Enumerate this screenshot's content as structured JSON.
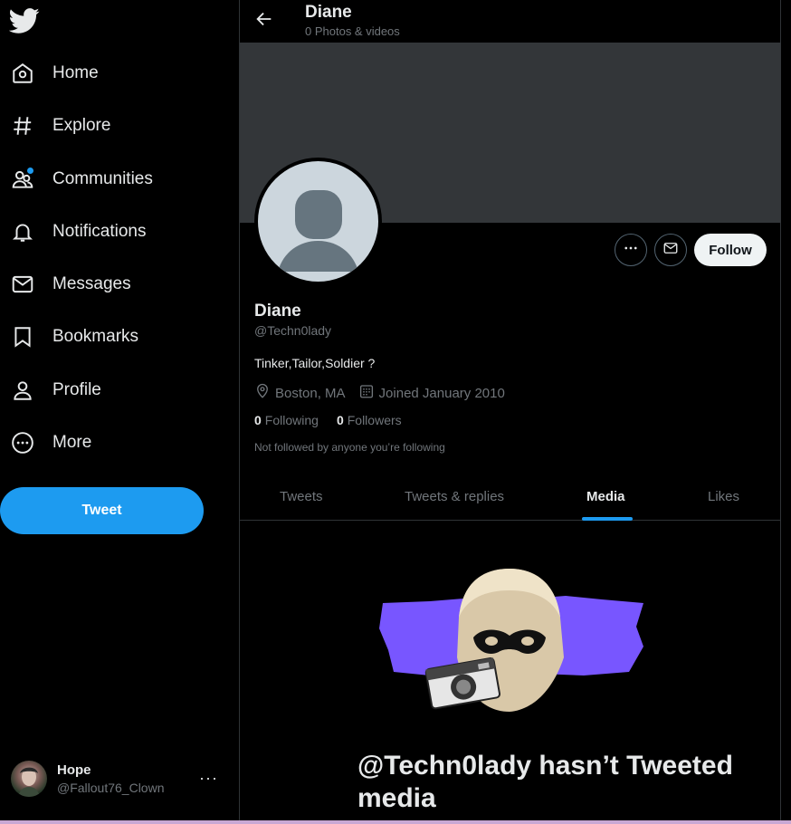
{
  "colors": {
    "accent": "#1d9bf0",
    "background": "#000000",
    "banner": "#333639",
    "text_primary": "#e7e9ea",
    "text_secondary": "#71767b",
    "follow_button_bg": "#eff3f4"
  },
  "sidebar": {
    "logo": "twitter-bird-icon",
    "items": [
      {
        "label": "Home",
        "icon": "home-icon"
      },
      {
        "label": "Explore",
        "icon": "hashtag-icon"
      },
      {
        "label": "Communities",
        "icon": "communities-icon"
      },
      {
        "label": "Notifications",
        "icon": "bell-icon"
      },
      {
        "label": "Messages",
        "icon": "envelope-icon"
      },
      {
        "label": "Bookmarks",
        "icon": "bookmark-icon"
      },
      {
        "label": "Profile",
        "icon": "person-icon"
      },
      {
        "label": "More",
        "icon": "more-circle-icon"
      }
    ],
    "tweet_label": "Tweet",
    "account": {
      "name": "Hope",
      "handle": "@Fallout76_Clown",
      "more": "···"
    }
  },
  "header": {
    "title": "Diane",
    "subtitle": "0 Photos & videos"
  },
  "profile": {
    "name": "Diane",
    "handle": "@Techn0lady",
    "bio": "Tinker,Tailor,Soldier ?",
    "location": "Boston, MA",
    "joined": "Joined January 2010",
    "following_count": "0",
    "following_label": "Following",
    "followers_count": "0",
    "followers_label": "Followers",
    "note": "Not followed by anyone you’re following",
    "follow_label": "Follow"
  },
  "tabs": [
    {
      "label": "Tweets",
      "active": false
    },
    {
      "label": "Tweets & replies",
      "active": false
    },
    {
      "label": "Media",
      "active": true
    },
    {
      "label": "Likes",
      "active": false
    }
  ],
  "empty_state": {
    "title": "@Techn0lady hasn’t Tweeted media"
  }
}
